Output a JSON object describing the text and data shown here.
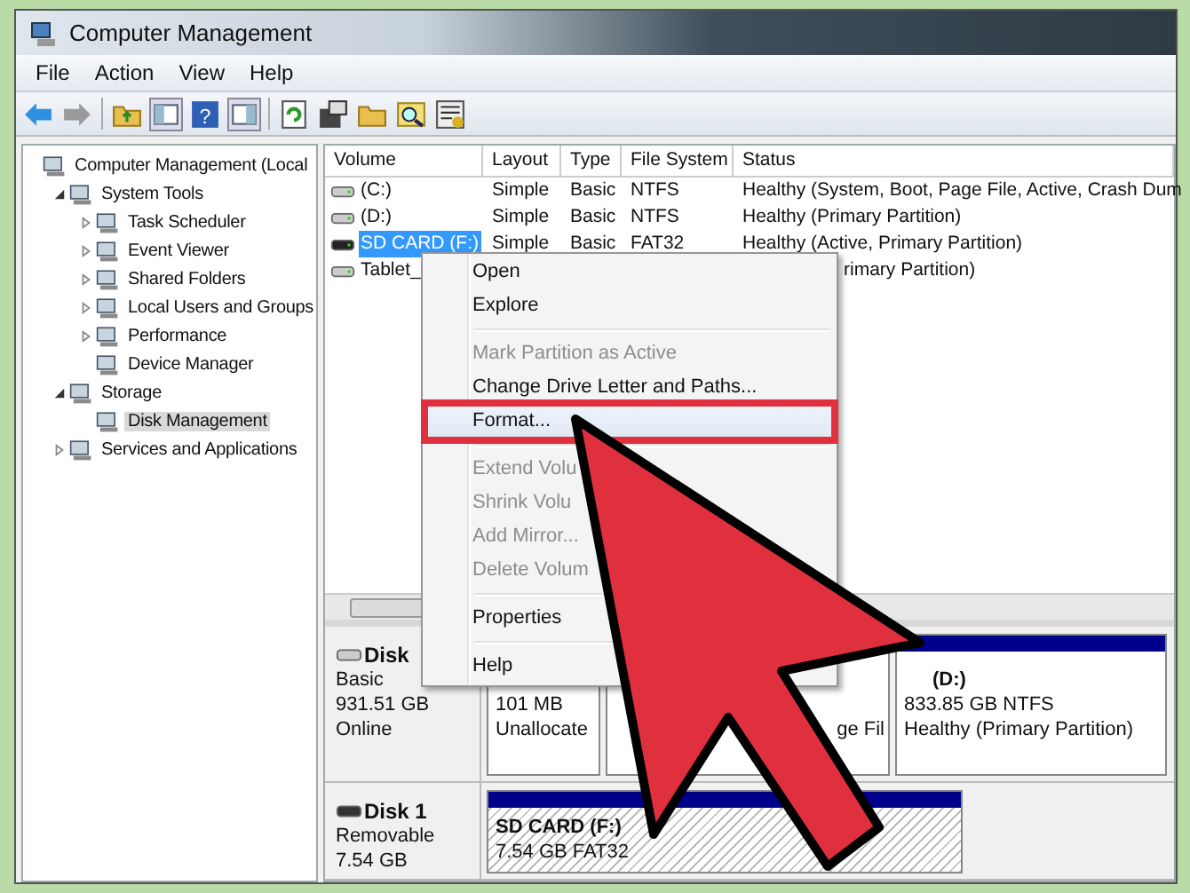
{
  "window": {
    "title": "Computer Management"
  },
  "menu": [
    "File",
    "Action",
    "View",
    "Help"
  ],
  "toolbar": {
    "help_glyph": "?"
  },
  "tree": [
    {
      "label": "Computer Management (Local",
      "selected": false,
      "children": [
        {
          "label": "System Tools",
          "expanded": true,
          "selected": false,
          "children": [
            {
              "label": "Task Scheduler",
              "expanded": false,
              "selected": false
            },
            {
              "label": "Event Viewer",
              "expanded": false,
              "selected": false
            },
            {
              "label": "Shared Folders",
              "expanded": false,
              "selected": false
            },
            {
              "label": "Local Users and Groups",
              "expanded": false,
              "selected": false
            },
            {
              "label": "Performance",
              "expanded": false,
              "selected": false
            },
            {
              "label": "Device Manager",
              "selected": false
            }
          ]
        },
        {
          "label": "Storage",
          "expanded": true,
          "selected": false,
          "children": [
            {
              "label": "Disk Management",
              "selected": true
            }
          ]
        },
        {
          "label": "Services and Applications",
          "expanded": false,
          "selected": false
        }
      ]
    }
  ],
  "table": {
    "columns": [
      "Volume",
      "Layout",
      "Type",
      "File System",
      "Status"
    ],
    "rows": [
      {
        "volume": "(C:)",
        "layout": "Simple",
        "type": "Basic",
        "file_system": "NTFS",
        "status": "Healthy (System, Boot, Page File, Active, Crash Dum",
        "selected": false
      },
      {
        "volume": "(D:)",
        "layout": "Simple",
        "type": "Basic",
        "file_system": "NTFS",
        "status": "Healthy (Primary Partition)",
        "selected": false
      },
      {
        "volume": "SD CARD (F:)",
        "layout": "Simple",
        "type": "Basic",
        "file_system": "FAT32",
        "status": "Healthy (Active, Primary Partition)",
        "selected": true
      },
      {
        "volume": "Tablet_",
        "status": "rimary Partition)",
        "selected": false
      }
    ]
  },
  "context_menu": [
    {
      "kind": "item",
      "label": "Open",
      "disabled": false,
      "selected": false
    },
    {
      "kind": "item",
      "label": "Explore",
      "disabled": false,
      "selected": false
    },
    {
      "kind": "separator"
    },
    {
      "kind": "item",
      "label": "Mark Partition as Active",
      "disabled": true,
      "selected": false
    },
    {
      "kind": "item",
      "label": "Change Drive Letter and Paths...",
      "disabled": false,
      "selected": false
    },
    {
      "kind": "item",
      "label": "Format...",
      "disabled": false,
      "selected": true
    },
    {
      "kind": "separator"
    },
    {
      "kind": "item",
      "label": "Extend Volu",
      "disabled": true,
      "selected": false
    },
    {
      "kind": "item",
      "label": "Shrink Volu",
      "disabled": true,
      "selected": false
    },
    {
      "kind": "item",
      "label": "Add Mirror...",
      "disabled": true,
      "selected": false
    },
    {
      "kind": "item",
      "label": "Delete Volum",
      "disabled": true,
      "selected": false
    },
    {
      "kind": "separator"
    },
    {
      "kind": "item",
      "label": "Properties",
      "disabled": false,
      "selected": false
    },
    {
      "kind": "separator"
    },
    {
      "kind": "item",
      "label": "Help",
      "disabled": false,
      "selected": false
    }
  ],
  "disks": [
    {
      "name": "Disk",
      "details": [
        "Basic",
        "931.51 GB",
        "Online"
      ],
      "partitions": [
        {
          "kind": "unallocated",
          "lines": [
            "101 MB",
            "Unallocate"
          ],
          "selected": false
        },
        {
          "kind": "primary",
          "lines": [
            "ge Fil"
          ],
          "selected": false
        },
        {
          "kind": "primary",
          "label": "(D:)",
          "lines": [
            "833.85 GB NTFS",
            "Healthy (Primary Partition)"
          ],
          "selected": false
        }
      ]
    },
    {
      "name": "Disk 1",
      "details": [
        "Removable",
        "7.54 GB"
      ],
      "partitions": [
        {
          "kind": "primary",
          "label": "SD CARD (F:)",
          "lines": [
            "7.54 GB FAT32"
          ],
          "selected": true
        }
      ]
    }
  ]
}
